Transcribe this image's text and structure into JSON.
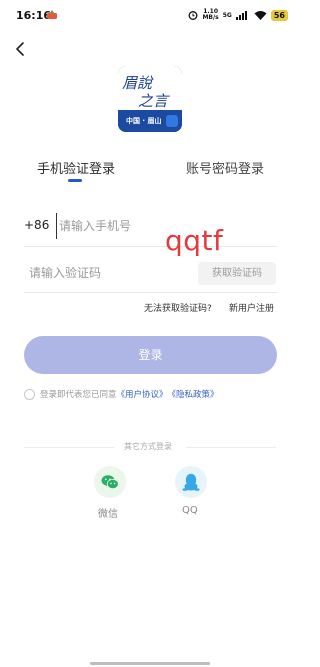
{
  "status_bar": {
    "time": "16:16",
    "speed_value": "1.10",
    "speed_unit": "MB/s",
    "network": "5G",
    "battery": "56"
  },
  "logo": {
    "title_glyphs": "眉說之言",
    "footer_text": "中国 · 眉山"
  },
  "tabs": [
    {
      "label": "手机验证登录",
      "active": true
    },
    {
      "label": "账号密码登录",
      "active": false
    }
  ],
  "phone": {
    "prefix": "+86",
    "placeholder": "请输入手机号"
  },
  "watermark": "qqtf",
  "code": {
    "placeholder": "请输入验证码",
    "get_code_label": "获取验证码"
  },
  "links": {
    "no_code": "无法获取验证码?",
    "register": "新用户注册"
  },
  "login_button": "登录",
  "agreement": {
    "prefix": "登录即代表您已同意",
    "user_agreement": "《用户协议》",
    "privacy_policy": "《隐私政策》"
  },
  "other_login": {
    "label": "其它方式登录",
    "wechat": "微信",
    "qq": "QQ"
  },
  "colors": {
    "accent": "#2e55c7",
    "login_button": "#aeb6e6",
    "link": "#3660c9",
    "wechat": "#2aae67",
    "qq": "#37a7e6"
  }
}
